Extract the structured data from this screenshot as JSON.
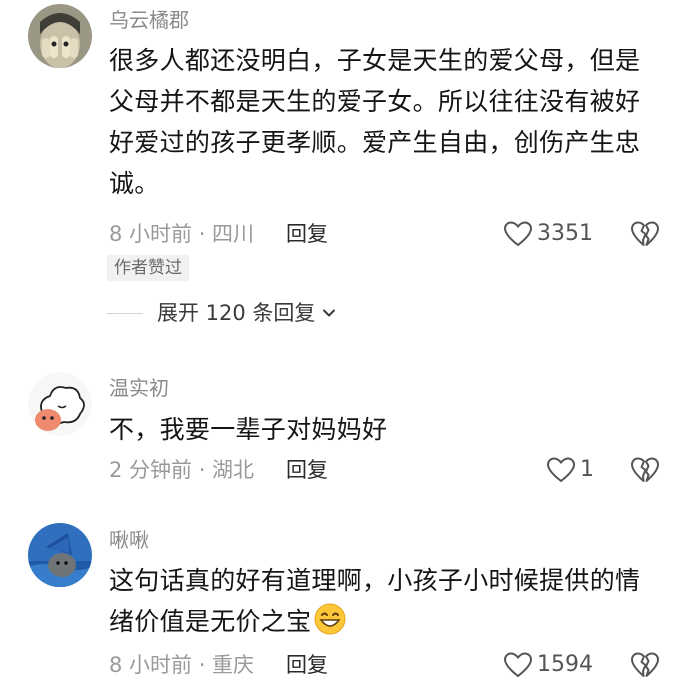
{
  "comments": [
    {
      "username": "乌云橘郡",
      "lines": [
        "很多人都还没明白，子女是天生的爱父母，但是",
        "父母并不都是天生的爱子女。所以往往没有被好",
        "好爱过的孩子更孝顺。爱产生自由，创伤产生忠",
        "诚。"
      ],
      "time_location": "8 小时前 · 四川",
      "reply_label": "回复",
      "likes": "3351",
      "badge": "作者赞过",
      "expand_label": "展开 120 条回复"
    },
    {
      "username": "温实初",
      "lines": [
        "不，我要一辈子对妈妈好"
      ],
      "time_location": "2 分钟前 · 湖北",
      "reply_label": "回复",
      "likes": "1"
    },
    {
      "username": "啾啾",
      "lines": [
        "这句话真的好有道理啊，小孩子小时候提供的情",
        "绪价值是无价之宝"
      ],
      "trailing_emoji": "grinning-face-emoji",
      "time_location": "8 小时前 · 重庆",
      "reply_label": "回复",
      "likes": "1594"
    }
  ],
  "icons": {
    "like": "heart-outline-icon",
    "dislike": "broken-heart-icon",
    "expand": "chevron-down-icon"
  }
}
